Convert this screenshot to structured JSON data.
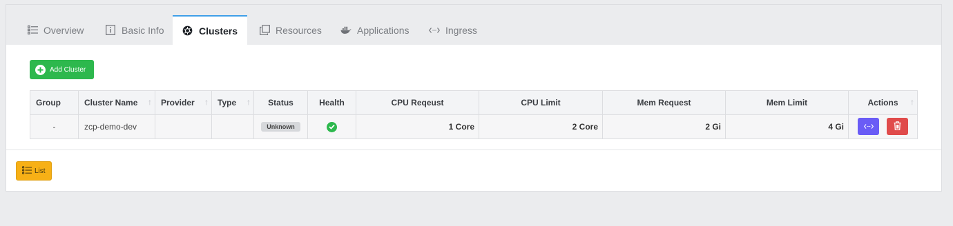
{
  "tabs": [
    {
      "label": "Overview",
      "icon": "list-icon"
    },
    {
      "label": "Basic Info",
      "icon": "info-icon"
    },
    {
      "label": "Clusters",
      "icon": "kubernetes-icon"
    },
    {
      "label": "Resources",
      "icon": "copy-icon"
    },
    {
      "label": "Applications",
      "icon": "docker-icon"
    },
    {
      "label": "Ingress",
      "icon": "code-icon"
    }
  ],
  "active_tab": "Clusters",
  "toolbar": {
    "add_cluster_label": "Add Cluster"
  },
  "table": {
    "columns": [
      "Group",
      "Cluster Name",
      "Provider",
      "Type",
      "Status",
      "Health",
      "CPU Reqeust",
      "CPU Limit",
      "Mem Request",
      "Mem Limit",
      "Actions"
    ],
    "rows": [
      {
        "group": "-",
        "cluster_name": "zcp-demo-dev",
        "provider": "",
        "type": "",
        "status": "Unknown",
        "health": "healthy",
        "cpu_request": "1 Core",
        "cpu_limit": "2 Core",
        "mem_request": "2 Gi",
        "mem_limit": "4 Gi"
      }
    ]
  },
  "footer": {
    "list_label": "List"
  },
  "colors": {
    "accent": "#3f9fe8",
    "success": "#2db84d",
    "edit": "#6a5cf6",
    "delete": "#e04b4b",
    "warning": "#f7b016"
  }
}
